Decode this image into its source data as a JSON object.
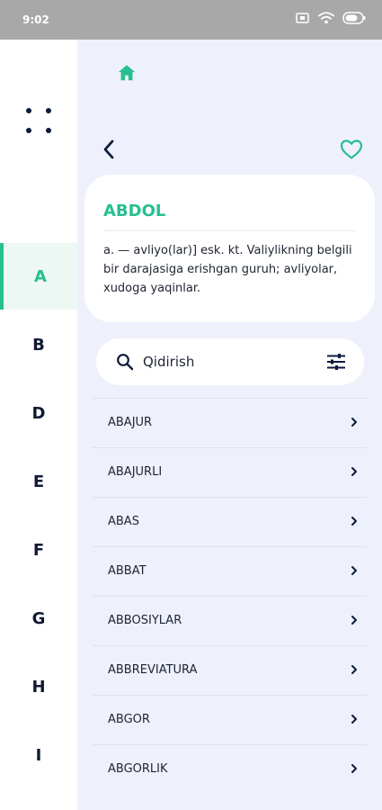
{
  "status_bar": {
    "time": "9:02",
    "icons": [
      "screen-record-icon",
      "wifi-icon",
      "battery-icon"
    ]
  },
  "sidebar": {
    "menu_icon": "dots-grid-icon",
    "letters": [
      "A",
      "B",
      "D",
      "E",
      "F",
      "G",
      "H",
      "I"
    ],
    "active_letter": "A"
  },
  "header": {
    "home_icon": "home-icon",
    "back_icon": "chevron-left-icon",
    "favorite_icon": "heart-icon"
  },
  "word_card": {
    "title": "ABDOL",
    "definition": "a.  — avliyo(lar)] esk. kt. Valiylikning belgili bir darajasiga erishgan guruh; avliyolar, xudoga yaqinlar."
  },
  "search": {
    "placeholder": "Qidirish",
    "value": ""
  },
  "word_list": [
    "ABAJUR",
    "ABAJURLI",
    "ABAS",
    "ABBAT",
    "ABBOSIYLAR",
    "ABBREVIATURA",
    "ABGOR",
    "ABGORLIK"
  ],
  "colors": {
    "accent": "#27bf8f",
    "panel_background": "#eef1fb",
    "text": "#1e2433",
    "status_bar": "#a8a8a8"
  }
}
